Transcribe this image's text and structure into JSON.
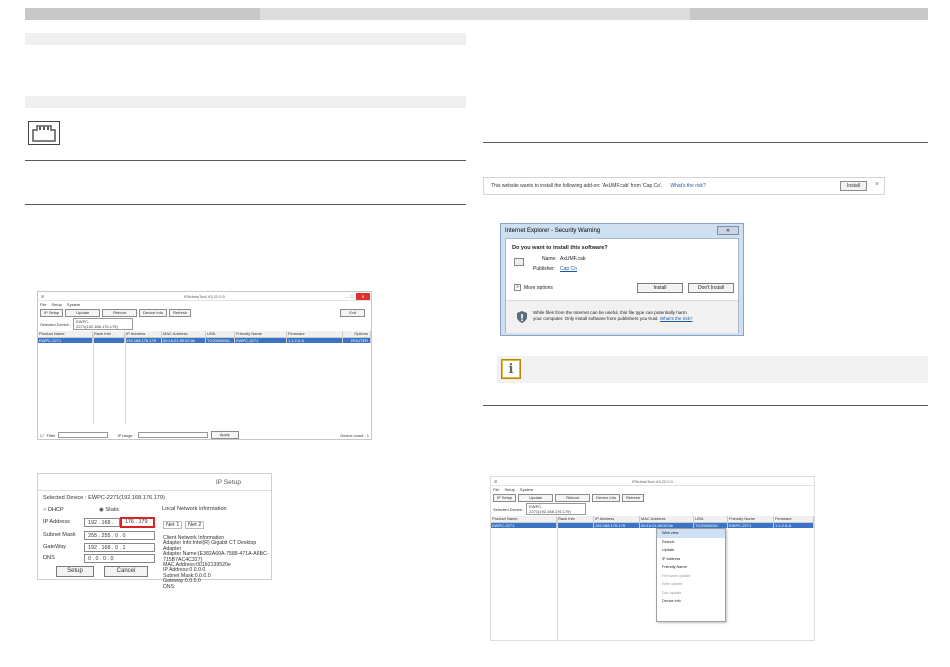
{
  "ie_bar": {
    "message": "This website wants to install the following add-on: 'AxUMF.cab' from 'Cap Co'.",
    "risk_link": "What's the risk?",
    "install": "Install",
    "close": "×"
  },
  "ie_dialog": {
    "title": "Internet Explorer - Security Warning",
    "question": "Do you want to install this software?",
    "name_label": "Name:",
    "name_value": "AxUMF.cab",
    "publisher_label": "Publisher:",
    "publisher_value": "Cap Co",
    "more_options": "More options",
    "install": "Install",
    "dont_install": "Don't Install",
    "warning_line1": "While files from the Internet can be useful, this file type can potentially harm",
    "warning_line2": "your computer. Only install software from publishers you trust.",
    "risk_link": "What's the risk?"
  },
  "ipadmin1": {
    "title": "IPAdminTool-V3.22.0.0",
    "menu": [
      "File",
      "Setup",
      "System"
    ],
    "buttons": [
      "IP Setup",
      "Update",
      "Reboot",
      "Device Info",
      "Refresh"
    ],
    "exit": "Exit",
    "selected_device": "Selected Device :",
    "selected_value": "EWPC-2271(192.168.176.179)",
    "columns": [
      "Product Name",
      "Rack Info",
      "IP Address",
      "MAC Address",
      "USN",
      "Friendly Name",
      "Firmware",
      "Options"
    ],
    "row": [
      "EWPC-2271",
      "",
      "192.168.176.179",
      "00:1b:21:39:52:0e",
      "TC00000001",
      "EWPC-2271",
      "1.1.2.0.A",
      "ROUTER"
    ],
    "filter": "Filter",
    "ip_range": "IP range :",
    "apply": "Apply",
    "device_count": "Device count : 1"
  },
  "ipsetup": {
    "title": "IP Setup",
    "selected": "Selected Device : EWPC-2271(192.168.176.179)",
    "dhcp": "DHCP",
    "static": "Static",
    "local": "Local Network information",
    "ip_label": "IP Address",
    "ip_a": "192 . 168 .",
    "ip_b": "176 . 179",
    "mask_label": "Subnet Mask",
    "mask": "255 . 255 . 0 . 0",
    "gw_label": "GateWay",
    "gw": "192 . 168 . 0 . 1",
    "dns_label": "DNS",
    "dns": "0 . 0 . 0 . 0",
    "net1": "Net 1",
    "net2": "Net 2",
    "info": [
      "Client Network Information",
      "Adapter Info:Intel(R) Gigabit CT Desktop Adapter",
      "Adapter Name:{E382A60A-7588-471A-A6BC-715B7AC4C327}",
      "MAC Address:001b2139520e",
      "IP Address:0.0.0.0",
      "Subnet Mask:0.0.0.0",
      "Gateway:0.0.0.0",
      "DNS:"
    ],
    "setup": "Setup",
    "cancel": "Cancel"
  },
  "ipadmin2": {
    "title": "IPAdminTool-V3.22.0.0",
    "menu": [
      "File",
      "Setup",
      "System"
    ],
    "buttons": [
      "IP Setup",
      "Update",
      "Reboot",
      "Device Info",
      "Refresh"
    ],
    "selected_device": "Selected Device :",
    "selected_value": "EWPC-2271(192.168.176.179)",
    "columns": [
      "Product Name",
      "Rack Info",
      "IP Address",
      "MAC Address",
      "USN",
      "Friendly Name",
      "Firmware"
    ],
    "row": [
      "EWPC-2271",
      "",
      "192.168.176.179",
      "00:1b:21:39:52:0e",
      "TC00000001",
      "EWPC-2271",
      "1.1.2.0.A"
    ],
    "context_menu": [
      "Web view",
      "Reboot",
      "Update",
      "IP Address",
      "Friendly Name",
      "Firmware update",
      "Web update",
      "Doc update",
      "Device info"
    ]
  }
}
